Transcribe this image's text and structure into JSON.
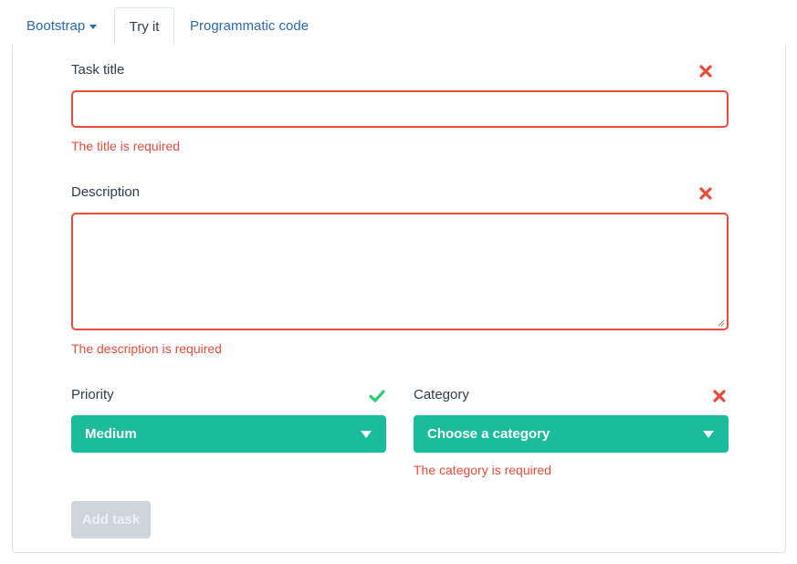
{
  "tabs": [
    {
      "label": "Bootstrap",
      "has_caret": true
    },
    {
      "label": "Try it",
      "active": true
    },
    {
      "label": "Programmatic code"
    }
  ],
  "form": {
    "title": {
      "label": "Task title",
      "value": "",
      "error": "The title is required",
      "status": "invalid"
    },
    "description": {
      "label": "Description",
      "value": "",
      "error": "The description is required",
      "status": "invalid"
    },
    "priority": {
      "label": "Priority",
      "selected": "Medium",
      "status": "valid"
    },
    "category": {
      "label": "Category",
      "selected": "Choose a category",
      "error": "The category is required",
      "status": "invalid"
    },
    "submit_label": "Add task",
    "submit_disabled": true
  },
  "colors": {
    "error": "#e74c3c",
    "success": "#2ecc71",
    "select_bg": "#1abc9c",
    "link": "#2c6aa8",
    "disabled_button": "#cfd5da"
  },
  "icons": {
    "invalid": "close-icon",
    "valid": "check-icon",
    "dropdown": "caret-down-icon"
  }
}
